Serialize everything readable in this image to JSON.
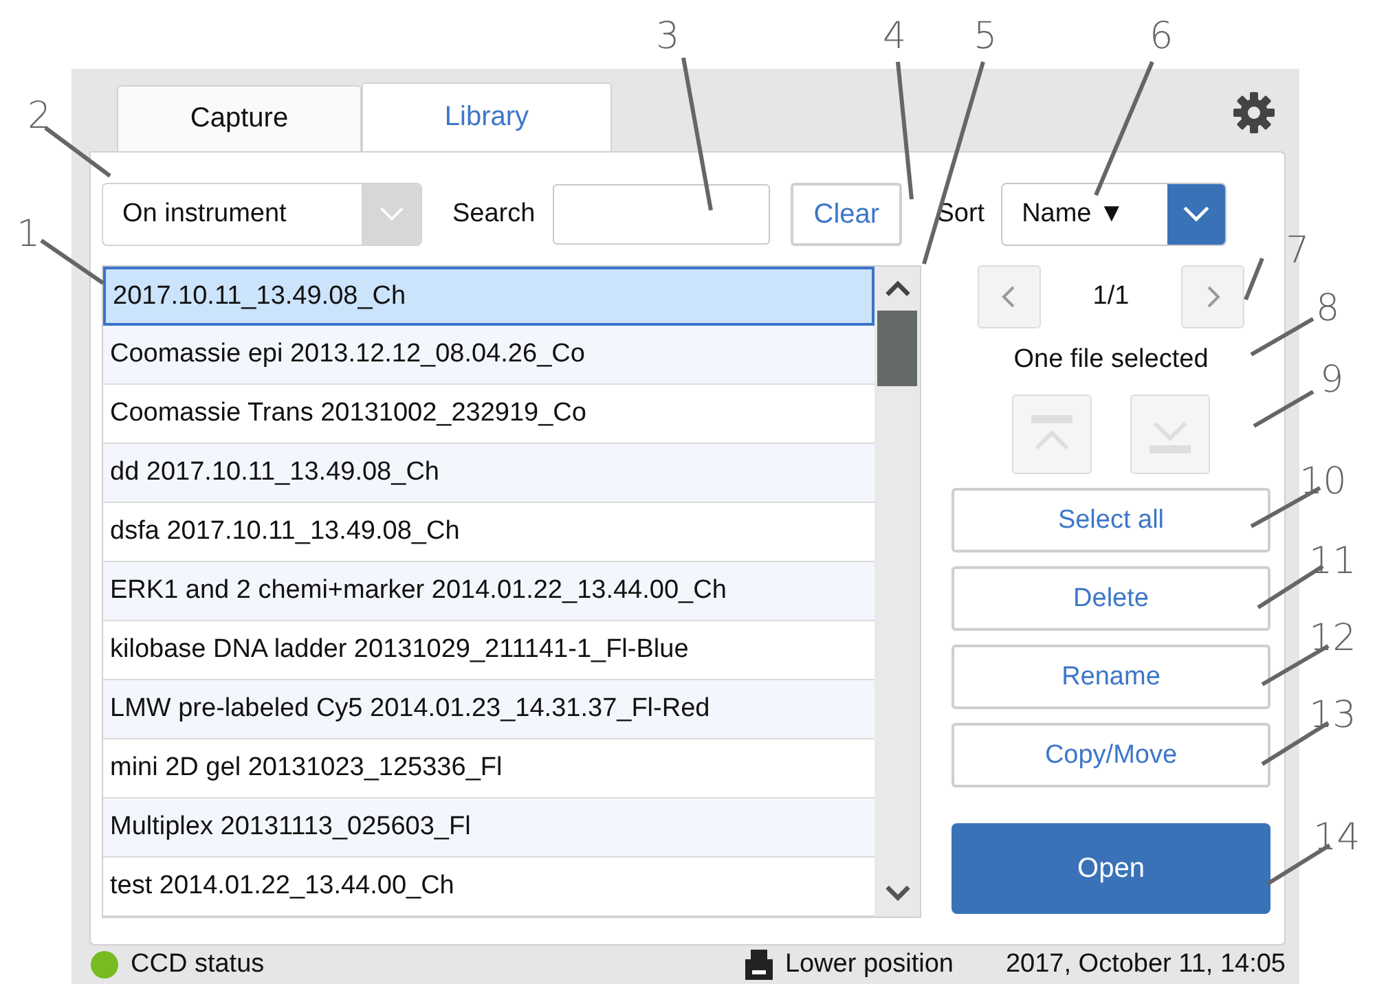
{
  "tabs": [
    {
      "label": "Capture",
      "selected": false
    },
    {
      "label": "Library",
      "selected": true
    }
  ],
  "toolbar": {
    "location_dropdown": {
      "value": "On instrument"
    },
    "search_label": "Search",
    "clear_button": "Clear",
    "sort_label": "Sort",
    "sort_dropdown": {
      "value": "Name ▼"
    }
  },
  "files": [
    {
      "name": "2017.10.11_13.49.08_Ch",
      "selected": true
    },
    {
      "name": "Coomassie epi 2013.12.12_08.04.26_Co",
      "selected": false
    },
    {
      "name": "Coomassie Trans 20131002_232919_Co",
      "selected": false
    },
    {
      "name": "dd 2017.10.11_13.49.08_Ch",
      "selected": false
    },
    {
      "name": "dsfa 2017.10.11_13.49.08_Ch",
      "selected": false
    },
    {
      "name": "ERK1 and 2 chemi+marker 2014.01.22_13.44.00_Ch",
      "selected": false
    },
    {
      "name": "kilobase DNA ladder 20131029_211141-1_Fl-Blue",
      "selected": false
    },
    {
      "name": "LMW pre-labeled Cy5 2014.01.23_14.31.37_Fl-Red",
      "selected": false
    },
    {
      "name": "mini 2D gel 20131023_125336_Fl",
      "selected": false
    },
    {
      "name": "Multiplex 20131113_025603_Fl",
      "selected": false
    },
    {
      "name": "test 2014.01.22_13.44.00_Ch",
      "selected": false
    }
  ],
  "side_panel": {
    "page_indicator": "1/1",
    "selection_status": "One file selected",
    "move_buttons_disabled": true,
    "actions": [
      "Select all",
      "Delete",
      "Rename",
      "Copy/Move"
    ],
    "open_button": "Open"
  },
  "status_bar": {
    "ccd_status": {
      "label": "CCD status",
      "color": "#76bc21"
    },
    "position": "Lower position",
    "datetime": "2017, October 11, 14:05"
  },
  "callouts": [
    {
      "label": "1"
    },
    {
      "label": "2"
    },
    {
      "label": "3"
    },
    {
      "label": "4"
    },
    {
      "label": "5"
    },
    {
      "label": "6"
    },
    {
      "label": "7"
    },
    {
      "label": "8"
    },
    {
      "label": "9"
    },
    {
      "label": "10"
    },
    {
      "label": "11"
    },
    {
      "label": "12"
    },
    {
      "label": "13"
    },
    {
      "label": "14"
    }
  ]
}
